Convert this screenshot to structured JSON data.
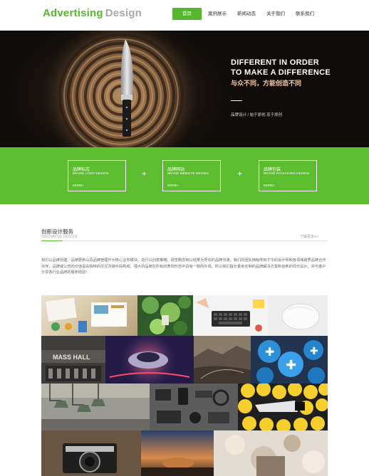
{
  "header": {
    "logo_primary": "Advertising",
    "logo_secondary": "Design",
    "nav": [
      "首页",
      "案例展示",
      "新闻动态",
      "关于我们",
      "联系我们"
    ]
  },
  "hero": {
    "line1": "DIFFERENT IN ORDER",
    "line2": "TO MAKE A DIFFERENCE",
    "cn": "与众不同，方能创造不同",
    "sub": "品牌设计 / 始于原创 忠于原创"
  },
  "services_boxes": [
    {
      "title": "品牌标志",
      "subtitle": "BRAND LOGO DESIGN",
      "more": "MORE+"
    },
    {
      "title": "品牌网站",
      "subtitle": "BRAND WEBSITE DESIGN",
      "more": "MORE+"
    },
    {
      "title": "品牌包装",
      "subtitle": "BRAND PACKAGING DESIGN",
      "more": "MORE+"
    }
  ],
  "plus_sign": "+",
  "innovative": {
    "title": "创新设计服务",
    "subtitle": "INNOVATIVE DESIGN",
    "more": "了解更多>>",
    "description": "我们以品牌创建、品牌更新以及品牌管理作为核心业务模块。进行以创意策略，视觉概念和以结果为导向的品牌沟通。我们的团队拥有既有才华的设计师和各领域跨界品牌合作伙伴，品牌或公司的价值是由独特的交互沟通手段构成。强大的品牌在所有的表现形态中具有一致的外观。所以我们擅长量身定制的品牌解决方案和创新的现代设计。并与客户分享各行业品牌的服务经验！"
  },
  "gallery": [
    "office-desk-photo",
    "plants-photo",
    "keyboard-photo",
    "mouse-photo",
    "mass-hall-photo",
    "car-photo",
    "landscape-photo",
    "blue-buttons-photo",
    "lamps-photo",
    "flatlay-photo",
    "lemons-photo",
    "camera-photo",
    "sunset-photo",
    "bokeh-photo"
  ]
}
